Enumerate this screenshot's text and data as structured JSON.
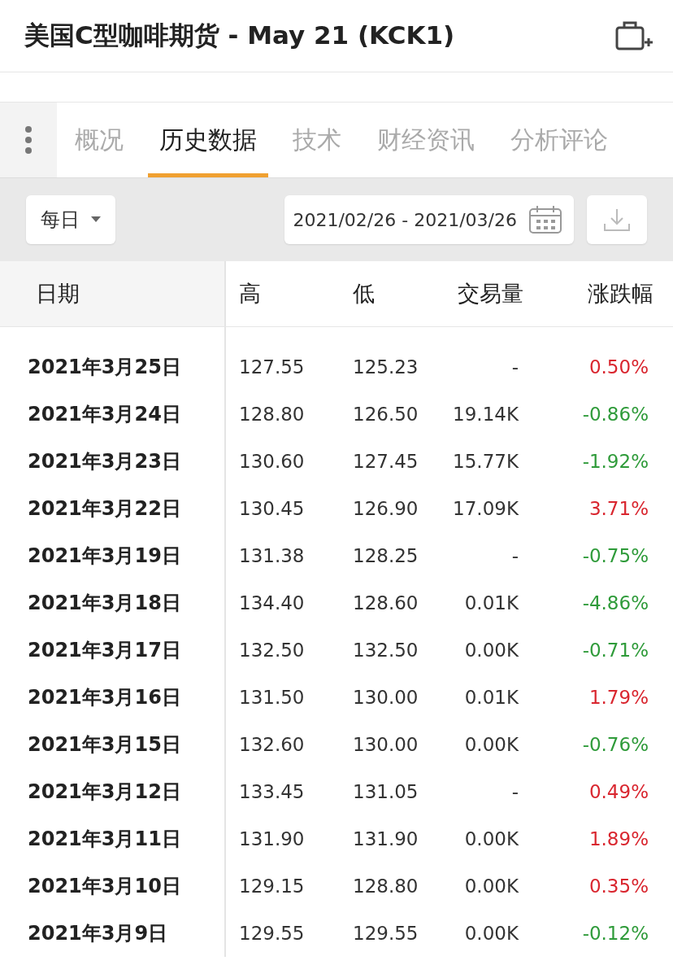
{
  "header": {
    "title": "美国C型咖啡期货 - May 21 (KCK1)"
  },
  "tabs": [
    {
      "label": "概况",
      "selected": false
    },
    {
      "label": "历史数据",
      "selected": true
    },
    {
      "label": "技术",
      "selected": false
    },
    {
      "label": "财经资讯",
      "selected": false
    },
    {
      "label": "分析评论",
      "selected": false
    }
  ],
  "toolbar": {
    "period": "每日",
    "date_range": "2021/02/26 - 2021/03/26"
  },
  "table": {
    "columns": [
      "日期",
      "高",
      "低",
      "交易量",
      "涨跌幅"
    ],
    "rows": [
      {
        "date": "2021年3月25日",
        "high": "127.55",
        "low": "125.23",
        "volume": "-",
        "change": "0.50%",
        "color": "#d9262f"
      },
      {
        "date": "2021年3月24日",
        "high": "128.80",
        "low": "126.50",
        "volume": "19.14K",
        "change": "-0.86%",
        "color": "#2f9b3a"
      },
      {
        "date": "2021年3月23日",
        "high": "130.60",
        "low": "127.45",
        "volume": "15.77K",
        "change": "-1.92%",
        "color": "#2f9b3a"
      },
      {
        "date": "2021年3月22日",
        "high": "130.45",
        "low": "126.90",
        "volume": "17.09K",
        "change": "3.71%",
        "color": "#d9262f"
      },
      {
        "date": "2021年3月19日",
        "high": "131.38",
        "low": "128.25",
        "volume": "-",
        "change": "-0.75%",
        "color": "#2f9b3a"
      },
      {
        "date": "2021年3月18日",
        "high": "134.40",
        "low": "128.60",
        "volume": "0.01K",
        "change": "-4.86%",
        "color": "#2f9b3a"
      },
      {
        "date": "2021年3月17日",
        "high": "132.50",
        "low": "132.50",
        "volume": "0.00K",
        "change": "-0.71%",
        "color": "#2f9b3a"
      },
      {
        "date": "2021年3月16日",
        "high": "131.50",
        "low": "130.00",
        "volume": "0.01K",
        "change": "1.79%",
        "color": "#d9262f"
      },
      {
        "date": "2021年3月15日",
        "high": "132.60",
        "low": "130.00",
        "volume": "0.00K",
        "change": "-0.76%",
        "color": "#2f9b3a"
      },
      {
        "date": "2021年3月12日",
        "high": "133.45",
        "low": "131.05",
        "volume": "-",
        "change": "0.49%",
        "color": "#d9262f"
      },
      {
        "date": "2021年3月11日",
        "high": "131.90",
        "low": "131.90",
        "volume": "0.00K",
        "change": "1.89%",
        "color": "#d9262f"
      },
      {
        "date": "2021年3月10日",
        "high": "129.15",
        "low": "128.80",
        "volume": "0.00K",
        "change": "0.35%",
        "color": "#d9262f"
      },
      {
        "date": "2021年3月9日",
        "high": "129.55",
        "low": "129.55",
        "volume": "0.00K",
        "change": "-0.12%",
        "color": "#2f9b3a"
      }
    ]
  }
}
